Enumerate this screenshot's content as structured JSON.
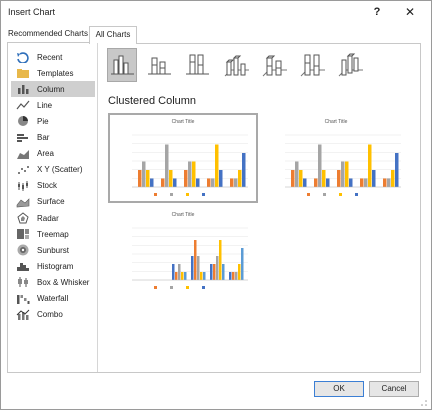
{
  "window": {
    "title": "Insert Chart",
    "help": "?",
    "close": "✕"
  },
  "tabs": [
    {
      "label": "Recommended Charts",
      "selected": false
    },
    {
      "label": "All Charts",
      "selected": true
    }
  ],
  "sidebar": {
    "items": [
      {
        "label": "Recent",
        "icon": "recent-icon"
      },
      {
        "label": "Templates",
        "icon": "folder-icon"
      },
      {
        "label": "Column",
        "icon": "column-chart-icon",
        "selected": true
      },
      {
        "label": "Line",
        "icon": "line-chart-icon"
      },
      {
        "label": "Pie",
        "icon": "pie-chart-icon"
      },
      {
        "label": "Bar",
        "icon": "bar-chart-icon"
      },
      {
        "label": "Area",
        "icon": "area-chart-icon"
      },
      {
        "label": "X Y (Scatter)",
        "icon": "scatter-chart-icon"
      },
      {
        "label": "Stock",
        "icon": "stock-chart-icon"
      },
      {
        "label": "Surface",
        "icon": "surface-chart-icon"
      },
      {
        "label": "Radar",
        "icon": "radar-chart-icon"
      },
      {
        "label": "Treemap",
        "icon": "treemap-chart-icon"
      },
      {
        "label": "Sunburst",
        "icon": "sunburst-chart-icon"
      },
      {
        "label": "Histogram",
        "icon": "histogram-chart-icon"
      },
      {
        "label": "Box & Whisker",
        "icon": "box-whisker-chart-icon"
      },
      {
        "label": "Waterfall",
        "icon": "waterfall-chart-icon"
      },
      {
        "label": "Combo",
        "icon": "combo-chart-icon"
      }
    ]
  },
  "subtypes": [
    {
      "name": "clustered-column",
      "selected": true
    },
    {
      "name": "stacked-column"
    },
    {
      "name": "100-stacked-column"
    },
    {
      "name": "3d-clustered-column"
    },
    {
      "name": "3d-stacked-column"
    },
    {
      "name": "3d-100-stacked-column"
    },
    {
      "name": "3d-column"
    }
  ],
  "main": {
    "section_title": "Clustered Column"
  },
  "previews": [
    {
      "title": "Chart Title",
      "style": "light",
      "selected": true
    },
    {
      "title": "Chart Title",
      "style": "dark",
      "selected": false
    },
    {
      "title": "Chart Title",
      "style": "light-swapped",
      "selected": false
    }
  ],
  "buttons": {
    "ok": "OK",
    "cancel": "Cancel"
  },
  "colors": {
    "series": [
      "#ed7d31",
      "#a5a5a5",
      "#ffc000",
      "#4472c4"
    ],
    "selection": "#cfcfcf"
  }
}
